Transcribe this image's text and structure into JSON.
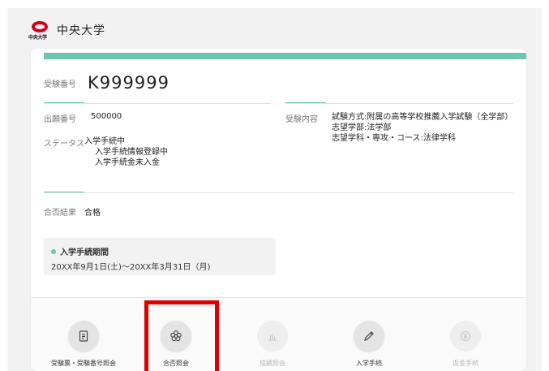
{
  "header": {
    "logo_text": "中央大学",
    "university_name": "中央大学"
  },
  "card": {
    "exam_number": {
      "label": "受験番号",
      "value": "K999999"
    },
    "application_number": {
      "label": "出願番号",
      "value": "500000"
    },
    "status": {
      "label": "ステータス",
      "lines": [
        "入学手続中",
        "入学手続情報登録中",
        "入学手続金未入金"
      ]
    },
    "exam_content": {
      "label": "受験内容",
      "lines": [
        "試験方式:附属の高等学校推薦入学試験（全学部）",
        "志望学部:法学部",
        "志望学科・専攻・コース:法律学科"
      ]
    },
    "result": {
      "label": "合否結果",
      "value": "合格"
    },
    "period": {
      "title": "入学手続期間",
      "dates": "20XX年9月1日(土)～20XX年3月31日（月)"
    }
  },
  "bottom_nav": [
    {
      "label": "受験票・受験番号照会",
      "icon": "document-icon",
      "enabled": true
    },
    {
      "label": "合否照会",
      "icon": "flower-icon",
      "enabled": true
    },
    {
      "label": "成績照会",
      "icon": "bar-chart-icon",
      "enabled": false
    },
    {
      "label": "入学手続",
      "icon": "pencil-icon",
      "enabled": true
    },
    {
      "label": "返金手続",
      "icon": "yen-icon",
      "enabled": false
    }
  ],
  "colors": {
    "accent": "#6bc6ac",
    "brand_red": "#d0021b",
    "highlight": "#e00000"
  }
}
